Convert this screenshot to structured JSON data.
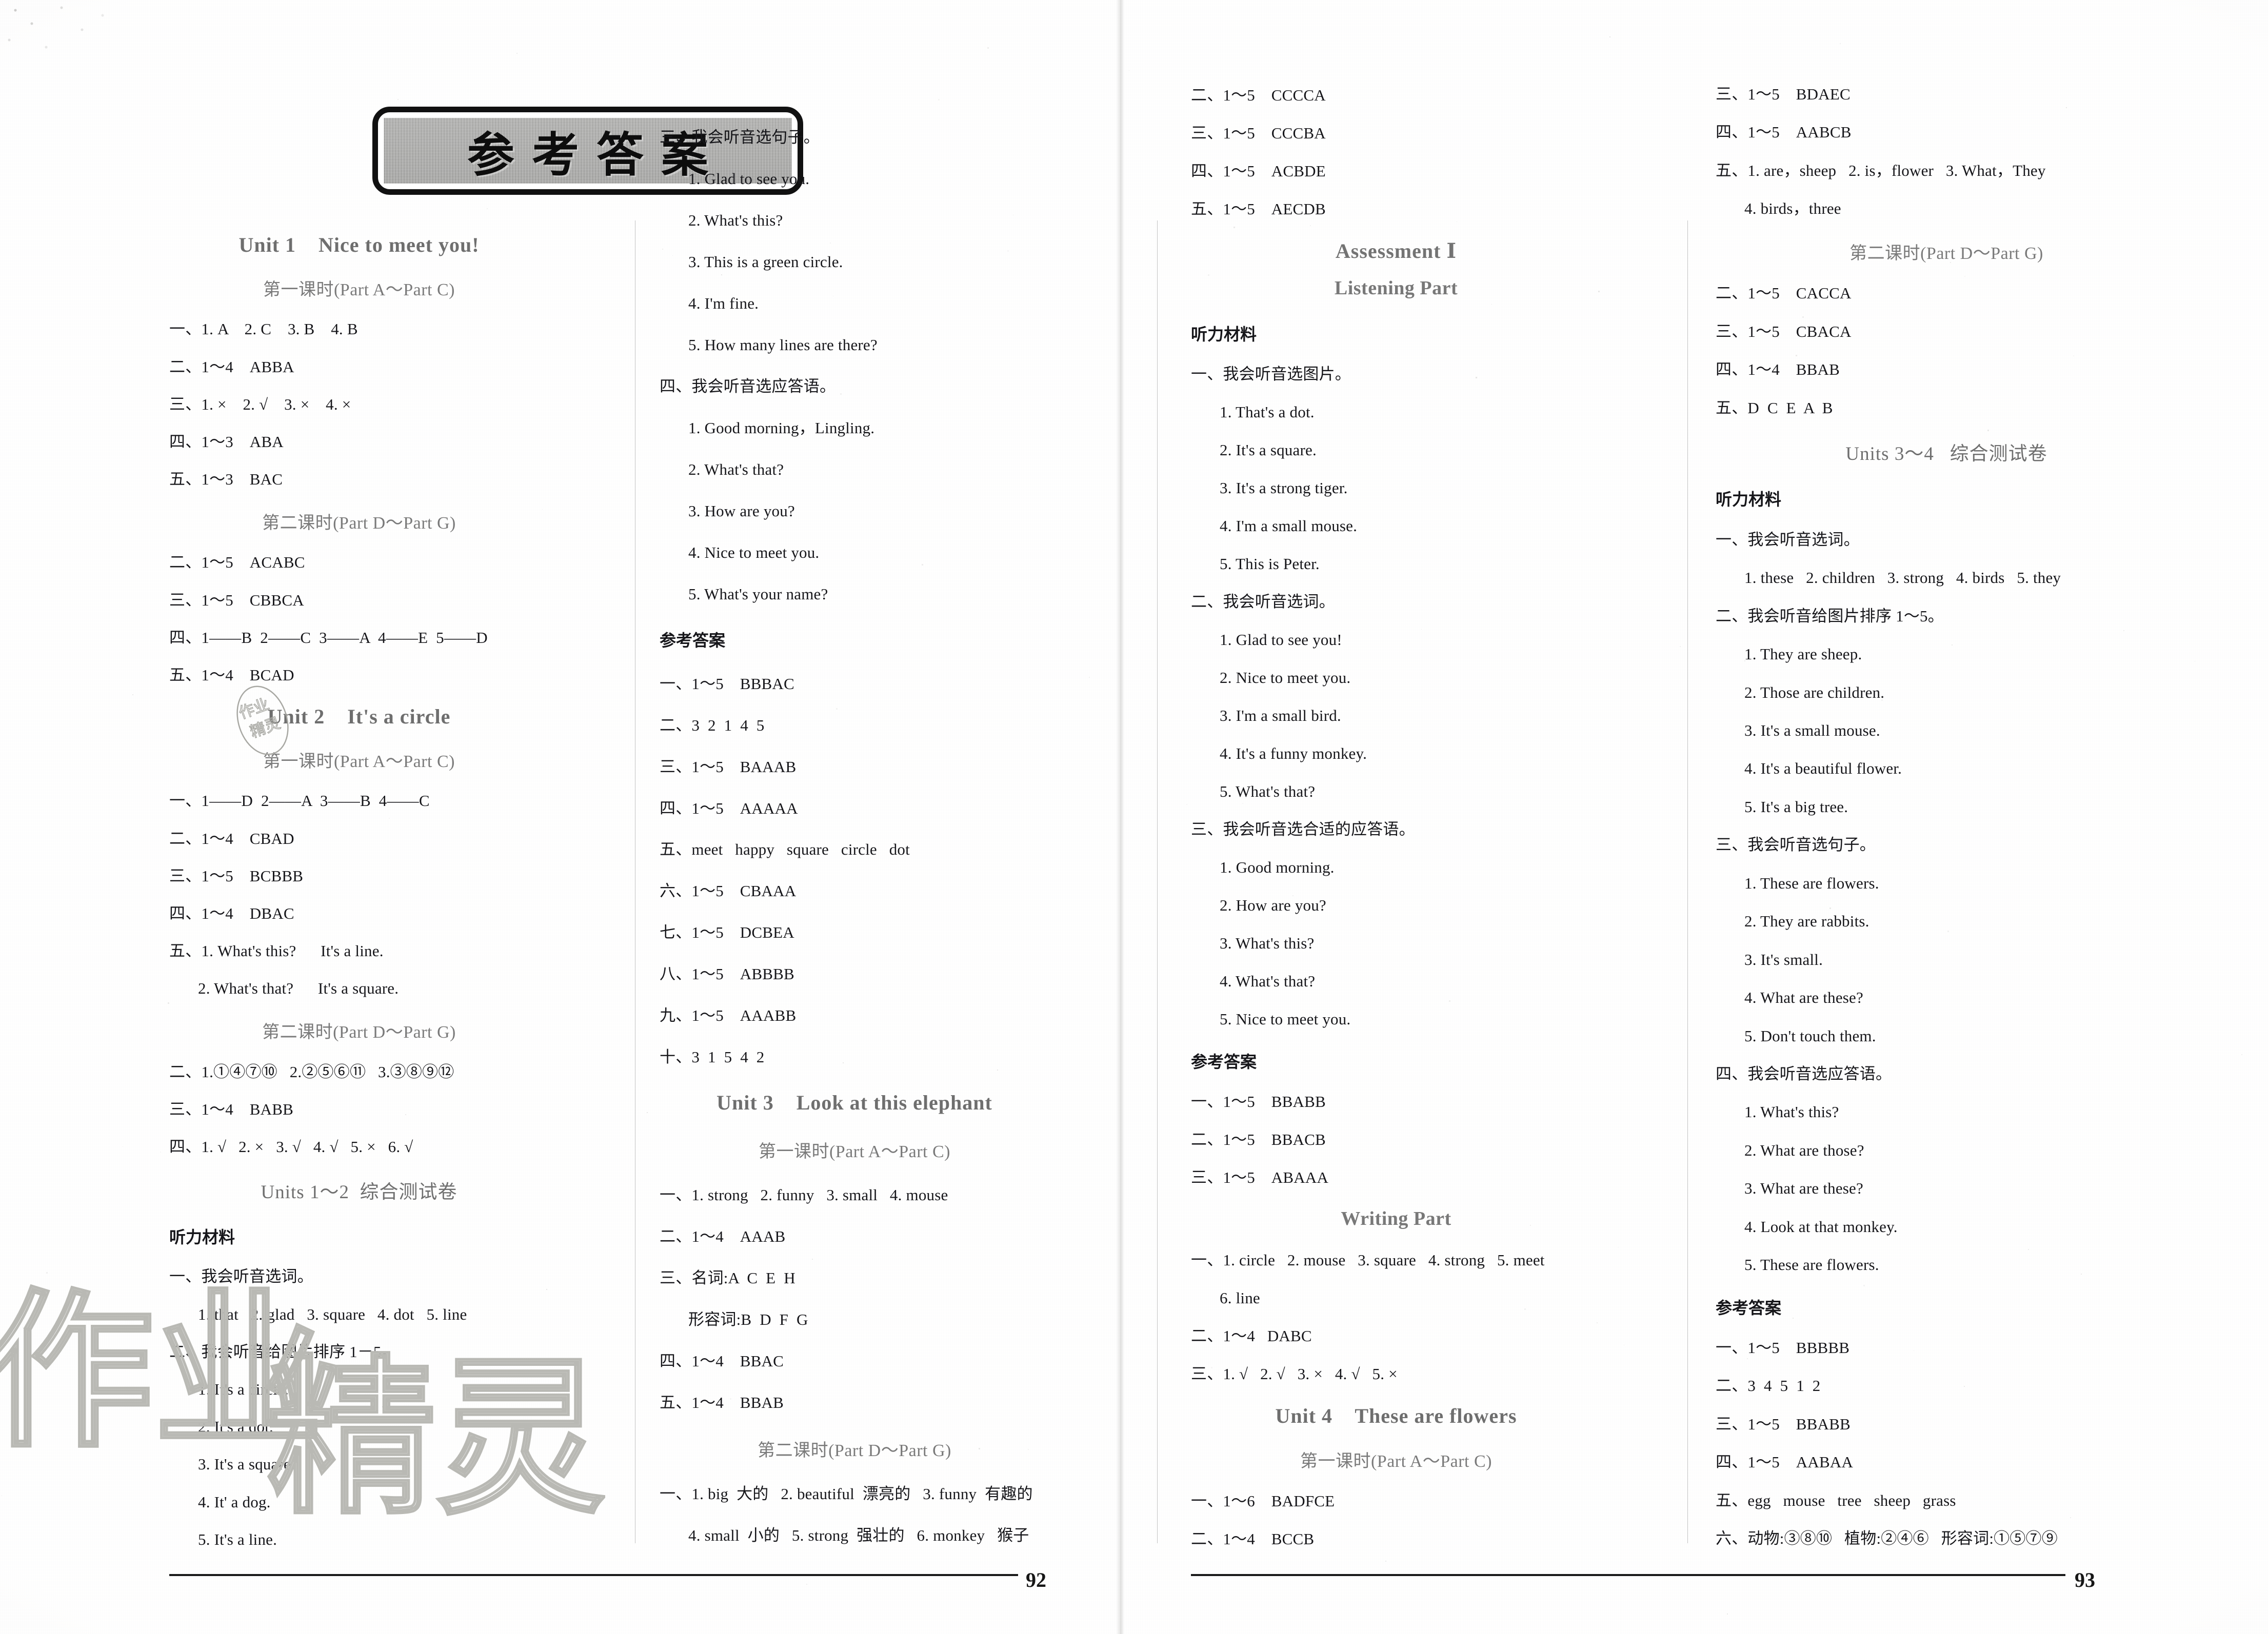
{
  "banner": {
    "text": "参考答案"
  },
  "folio": {
    "left": "92",
    "right": "93"
  },
  "labels": {
    "ref_answers": "参考答案",
    "listening_material": "听力材料"
  },
  "col1": [
    {
      "type": "unit",
      "text": "Unit 1    Nice to meet you!"
    },
    {
      "type": "sub",
      "text": "第一课时(Part A～Part C)"
    },
    {
      "type": "ans",
      "text": "一、1. A    2. C    3. B    4. B"
    },
    {
      "type": "ans",
      "text": "二、1～4    ABBA"
    },
    {
      "type": "ans",
      "text": "三、1. ×    2. √    3. ×    4. ×"
    },
    {
      "type": "ans",
      "text": "四、1～3    ABA"
    },
    {
      "type": "ans",
      "text": "五、1～3    BAC"
    },
    {
      "type": "sub",
      "text": "第二课时(Part D～Part G)"
    },
    {
      "type": "ans",
      "text": "二、1～5    ACABC"
    },
    {
      "type": "ans",
      "text": "三、1～5    CBBCA"
    },
    {
      "type": "ans",
      "text": "四、1——B  2——C  3——A  4——E  5——D"
    },
    {
      "type": "ans",
      "text": "五、1～4    BCAD"
    },
    {
      "type": "unit",
      "text": "Unit 2    It's a circle"
    },
    {
      "type": "sub",
      "text": "第一课时(Part A～Part C)"
    },
    {
      "type": "ans",
      "text": "一、1——D  2——A  3——B  4——C"
    },
    {
      "type": "ans",
      "text": "二、1～4    CBAD"
    },
    {
      "type": "ans",
      "text": "三、1～5    BCBBB"
    },
    {
      "type": "ans",
      "text": "四、1～4    DBAC"
    },
    {
      "type": "ans",
      "text": "五、1. What's this?      It's a line."
    },
    {
      "type": "ans-ind",
      "text": "2. What's that?      It's a square."
    },
    {
      "type": "sub",
      "text": "第二课时(Part D～Part G)"
    },
    {
      "type": "ans",
      "text": "二、1.①④⑦⑩   2.②⑤⑥⑪   3.③⑧⑨⑫"
    },
    {
      "type": "ans",
      "text": "三、1～4    BABB"
    },
    {
      "type": "ans",
      "text": "四、1. √   2. ×   3. √   4. √   5. ×   6. √"
    },
    {
      "type": "test",
      "text": "Units 1～2  综合测试卷"
    },
    {
      "type": "cnbold",
      "text": "听力材料"
    },
    {
      "type": "ans",
      "text": "一、我会听音选词。"
    },
    {
      "type": "ans-ind",
      "text": "1. that   2. glad   3. square   4. dot   5. line"
    },
    {
      "type": "ans",
      "text": "二、我会听音给图片排序 1－5。"
    },
    {
      "type": "ans-ind",
      "text": "1. It's a circle."
    },
    {
      "type": "ans-ind",
      "text": "2. It's a dot."
    },
    {
      "type": "ans-ind",
      "text": "3. It's a square."
    },
    {
      "type": "ans-ind",
      "text": "4. It' a dog."
    },
    {
      "type": "ans-ind",
      "text": "5. It's a line."
    }
  ],
  "col2": [
    {
      "type": "ans",
      "text": "三、我会听音选句子。"
    },
    {
      "type": "ans-ind",
      "text": "1. Glad to see you."
    },
    {
      "type": "ans-ind",
      "text": "2. What's this?"
    },
    {
      "type": "ans-ind",
      "text": "3. This is a green circle."
    },
    {
      "type": "ans-ind",
      "text": "4. I'm fine."
    },
    {
      "type": "ans-ind",
      "text": "5. How many lines are there?"
    },
    {
      "type": "ans",
      "text": "四、我会听音选应答语。"
    },
    {
      "type": "ans-ind",
      "text": "1. Good morning，Lingling."
    },
    {
      "type": "ans-ind",
      "text": "2. What's that?"
    },
    {
      "type": "ans-ind",
      "text": "3. How are you?"
    },
    {
      "type": "ans-ind",
      "text": "4. Nice to meet you."
    },
    {
      "type": "ans-ind",
      "text": "5. What's your name?"
    },
    {
      "type": "cnbold",
      "text": "参考答案"
    },
    {
      "type": "ans",
      "text": "一、1～5    BBBAC"
    },
    {
      "type": "ans",
      "text": "二、3  2  1  4  5"
    },
    {
      "type": "ans",
      "text": "三、1～5    BAAAB"
    },
    {
      "type": "ans",
      "text": "四、1～5    AAAAA"
    },
    {
      "type": "ans",
      "text": "五、meet   happy   square   circle   dot"
    },
    {
      "type": "ans",
      "text": "六、1～5    CBAAA"
    },
    {
      "type": "ans",
      "text": "七、1～5    DCBEA"
    },
    {
      "type": "ans",
      "text": "八、1～5    ABBBB"
    },
    {
      "type": "ans",
      "text": "九、1～5    AAABB"
    },
    {
      "type": "ans",
      "text": "十、3  1  5  4  2"
    },
    {
      "type": "unit",
      "text": "Unit 3    Look at this elephant"
    },
    {
      "type": "sub",
      "text": "第一课时(Part A～Part C)"
    },
    {
      "type": "ans",
      "text": "一、1. strong   2. funny   3. small   4. mouse"
    },
    {
      "type": "ans",
      "text": "二、1～4    AAAB"
    },
    {
      "type": "ans",
      "text": "三、名词:A  C  E  H"
    },
    {
      "type": "ans-ind",
      "text": "形容词:B  D  F  G"
    },
    {
      "type": "ans",
      "text": "四、1～4    BBAC"
    },
    {
      "type": "ans",
      "text": "五、1～4    BBAB"
    },
    {
      "type": "sub",
      "text": "第二课时(Part D～Part G)"
    },
    {
      "type": "ans",
      "text": "一、1. big  大的   2. beautiful  漂亮的   3. funny  有趣的"
    },
    {
      "type": "ans-ind",
      "text": "4. small  小的   5. strong  强壮的   6. monkey   猴子"
    }
  ],
  "col3": [
    {
      "type": "ans",
      "text": "二、1～5    CCCCA"
    },
    {
      "type": "ans",
      "text": "三、1～5    CCCBA"
    },
    {
      "type": "ans",
      "text": "四、1～5    ACBDE"
    },
    {
      "type": "ans",
      "text": "五、1～5    AECDB"
    },
    {
      "type": "assess",
      "text": "Assessment Ⅰ"
    },
    {
      "type": "part",
      "text": "Listening Part"
    },
    {
      "type": "cnbold",
      "text": "听力材料"
    },
    {
      "type": "ans",
      "text": "一、我会听音选图片。"
    },
    {
      "type": "ans-ind",
      "text": "1. That's a dot."
    },
    {
      "type": "ans-ind",
      "text": "2. It's a square."
    },
    {
      "type": "ans-ind",
      "text": "3. It's a strong tiger."
    },
    {
      "type": "ans-ind",
      "text": "4. I'm a small mouse."
    },
    {
      "type": "ans-ind",
      "text": "5. This is Peter."
    },
    {
      "type": "ans",
      "text": "二、我会听音选词。"
    },
    {
      "type": "ans-ind",
      "text": "1. Glad to see you!"
    },
    {
      "type": "ans-ind",
      "text": "2. Nice to meet you."
    },
    {
      "type": "ans-ind",
      "text": "3. I'm a small bird."
    },
    {
      "type": "ans-ind",
      "text": "4. It's a funny monkey."
    },
    {
      "type": "ans-ind",
      "text": "5. What's that?"
    },
    {
      "type": "ans",
      "text": "三、我会听音选合适的应答语。"
    },
    {
      "type": "ans-ind",
      "text": "1. Good morning."
    },
    {
      "type": "ans-ind",
      "text": "2. How are you?"
    },
    {
      "type": "ans-ind",
      "text": "3. What's this?"
    },
    {
      "type": "ans-ind",
      "text": "4. What's that?"
    },
    {
      "type": "ans-ind",
      "text": "5. Nice to meet you."
    },
    {
      "type": "cnbold",
      "text": "参考答案"
    },
    {
      "type": "ans",
      "text": "一、1～5    BBABB"
    },
    {
      "type": "ans",
      "text": "二、1～5    BBACB"
    },
    {
      "type": "ans",
      "text": "三、1～5    ABAAA"
    },
    {
      "type": "part",
      "text": "Writing Part"
    },
    {
      "type": "ans",
      "text": "一、1. circle   2. mouse   3. square   4. strong   5. meet"
    },
    {
      "type": "ans-ind",
      "text": "6. line"
    },
    {
      "type": "ans",
      "text": "二、1～4   DABC"
    },
    {
      "type": "ans",
      "text": "三、1. √   2. √   3. ×   4. √   5. ×"
    },
    {
      "type": "unit",
      "text": "Unit 4    These are flowers"
    },
    {
      "type": "sub",
      "text": "第一课时(Part A～Part C)"
    },
    {
      "type": "ans",
      "text": "一、1～6    BADFCE"
    },
    {
      "type": "ans",
      "text": "二、1～4    BCCB"
    }
  ],
  "col4": [
    {
      "type": "ans",
      "text": "三、1～5    BDAEC"
    },
    {
      "type": "ans",
      "text": "四、1～5    AABCB"
    },
    {
      "type": "ans",
      "text": "五、1. are，sheep   2. is，flower   3. What，They"
    },
    {
      "type": "ans-ind",
      "text": "4. birds，three"
    },
    {
      "type": "sub",
      "text": "第二课时(Part D～Part G)"
    },
    {
      "type": "ans",
      "text": "二、1～5    CACCA"
    },
    {
      "type": "ans",
      "text": "三、1～5    CBACA"
    },
    {
      "type": "ans",
      "text": "四、1～4    BBAB"
    },
    {
      "type": "ans",
      "text": "五、D  C  E  A  B"
    },
    {
      "type": "test",
      "text": "Units 3～4   综合测试卷"
    },
    {
      "type": "cnbold",
      "text": "听力材料"
    },
    {
      "type": "ans",
      "text": "一、我会听音选词。"
    },
    {
      "type": "ans-ind",
      "text": "1. these   2. children   3. strong   4. birds   5. they"
    },
    {
      "type": "ans",
      "text": "二、我会听音给图片排序 1～5。"
    },
    {
      "type": "ans-ind",
      "text": "1. They are sheep."
    },
    {
      "type": "ans-ind",
      "text": "2. Those are children."
    },
    {
      "type": "ans-ind",
      "text": "3. It's a small mouse."
    },
    {
      "type": "ans-ind",
      "text": "4. It's a beautiful flower."
    },
    {
      "type": "ans-ind",
      "text": "5. It's a big tree."
    },
    {
      "type": "ans",
      "text": "三、我会听音选句子。"
    },
    {
      "type": "ans-ind",
      "text": "1. These are flowers."
    },
    {
      "type": "ans-ind",
      "text": "2. They are rabbits."
    },
    {
      "type": "ans-ind",
      "text": "3. It's small."
    },
    {
      "type": "ans-ind",
      "text": "4. What are these?"
    },
    {
      "type": "ans-ind",
      "text": "5. Don't touch them."
    },
    {
      "type": "ans",
      "text": "四、我会听音选应答语。"
    },
    {
      "type": "ans-ind",
      "text": "1. What's this?"
    },
    {
      "type": "ans-ind",
      "text": "2. What are those?"
    },
    {
      "type": "ans-ind",
      "text": "3. What are these?"
    },
    {
      "type": "ans-ind",
      "text": "4. Look at that monkey."
    },
    {
      "type": "ans-ind",
      "text": "5. These are flowers."
    },
    {
      "type": "cnbold",
      "text": "参考答案"
    },
    {
      "type": "ans",
      "text": "一、1～5    BBBBB"
    },
    {
      "type": "ans",
      "text": "二、3  4  5  1  2"
    },
    {
      "type": "ans",
      "text": "三、1～5    BBABB"
    },
    {
      "type": "ans",
      "text": "四、1～5    AABAA"
    },
    {
      "type": "ans",
      "text": "五、egg   mouse   tree   sheep   grass"
    },
    {
      "type": "ans",
      "text": "六、动物:③⑧⑩   植物:②④⑥   形容词:①⑤⑦⑨"
    }
  ],
  "watermark": {
    "text": "作业精灵",
    "stamp_text": "作业精灵"
  }
}
